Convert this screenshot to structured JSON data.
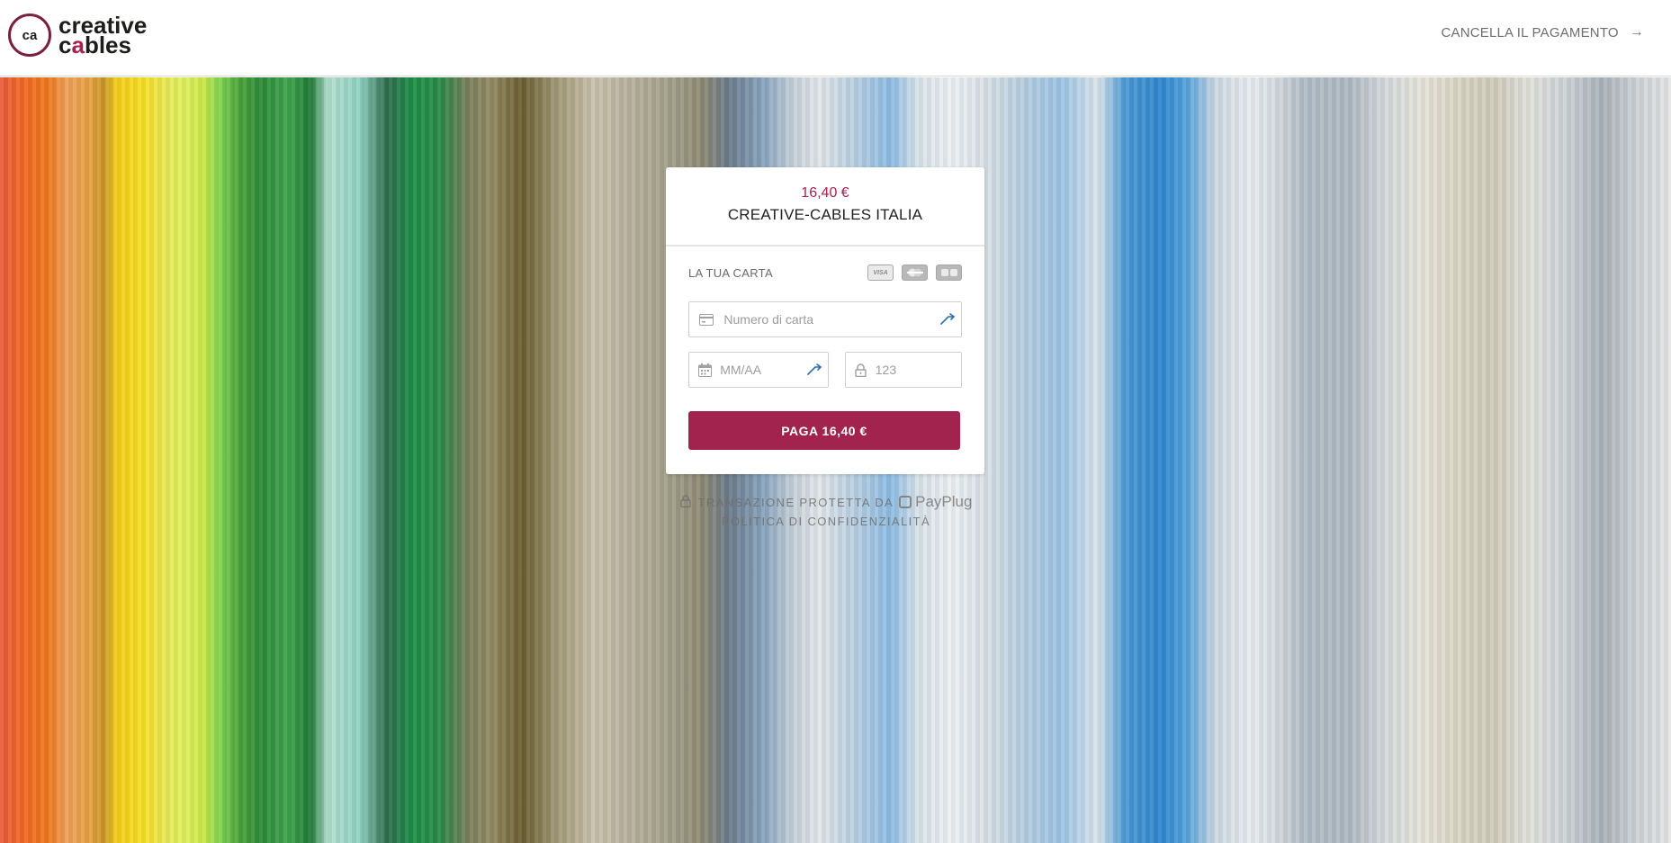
{
  "header": {
    "logo": {
      "monogram": "ca",
      "line1": "creative",
      "line2_prefix": "c",
      "line2_accent": "a",
      "line2_suffix": "bles"
    },
    "cancel_label": "CANCELLA IL PAGAMENTO",
    "cancel_icon": "arrow-right-icon"
  },
  "payment": {
    "amount": "16,40 €",
    "merchant": "CREATIVE-CABLES ITALIA",
    "card_label": "LA TUA CARTA",
    "brands": [
      "visa-icon",
      "mastercard-icon",
      "cb-icon"
    ],
    "brand_visa_text": "VISA",
    "card_number": {
      "placeholder": "Numero di carta",
      "value": "",
      "icon": "credit-card-icon"
    },
    "expiry": {
      "placeholder": "MM/AA",
      "value": "",
      "icon": "calendar-icon"
    },
    "cvc": {
      "placeholder": "123",
      "value": "",
      "icon": "lock-icon"
    },
    "pay_button": "PAGA 16,40 €"
  },
  "footer": {
    "secure_text": "TRANSAZIONE PROTETTA DA",
    "provider": "PayPlug",
    "privacy": "POLITICA DI CONFIDENZIALITÀ"
  },
  "colors": {
    "brand": "#a3234f",
    "text_muted": "#6d6d6d"
  }
}
